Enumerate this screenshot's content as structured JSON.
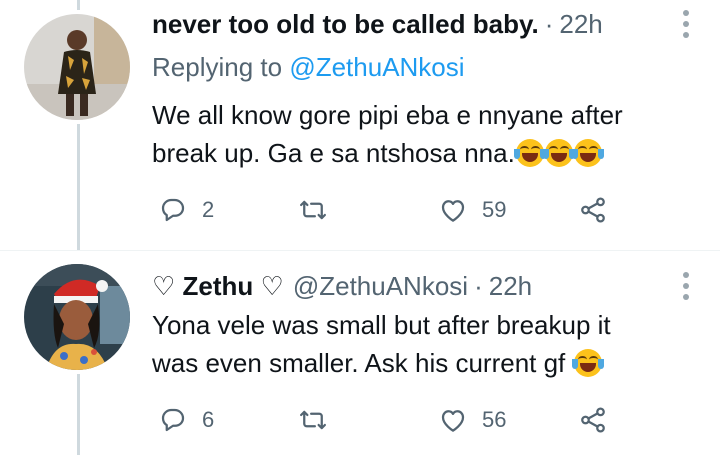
{
  "tweets": [
    {
      "display_name": "never too old to be called baby.",
      "dot": "·",
      "time": "22h",
      "replying_prefix": "Replying to ",
      "replying_handle": "@ZethuANkosi",
      "text_line1": "We all know gore pipi eba e nnyane after",
      "text_line2": "break up. Ga e sa ntshosa nna.",
      "emoji_count": 3,
      "emoji_name": "face-with-tears-of-joy",
      "replies": "2",
      "retweets": "",
      "likes": "59"
    },
    {
      "display_name": "♡ Zethu ♡",
      "handle": "@ZethuANkosi",
      "dot": "·",
      "time": "22h",
      "text_line1": "Yona vele was small but after breakup it",
      "text_line2": "was even smaller. Ask his current gf",
      "emoji_count": 1,
      "emoji_name": "face-with-tears-of-joy",
      "replies": "6",
      "retweets": "",
      "likes": "56"
    }
  ],
  "colors": {
    "text": "#0f1419",
    "secondary": "#536471",
    "link": "#1d9bf0",
    "thread_line": "#cfd9de"
  },
  "icons": [
    "reply-icon",
    "retweet-icon",
    "like-icon",
    "share-icon",
    "more-icon"
  ]
}
